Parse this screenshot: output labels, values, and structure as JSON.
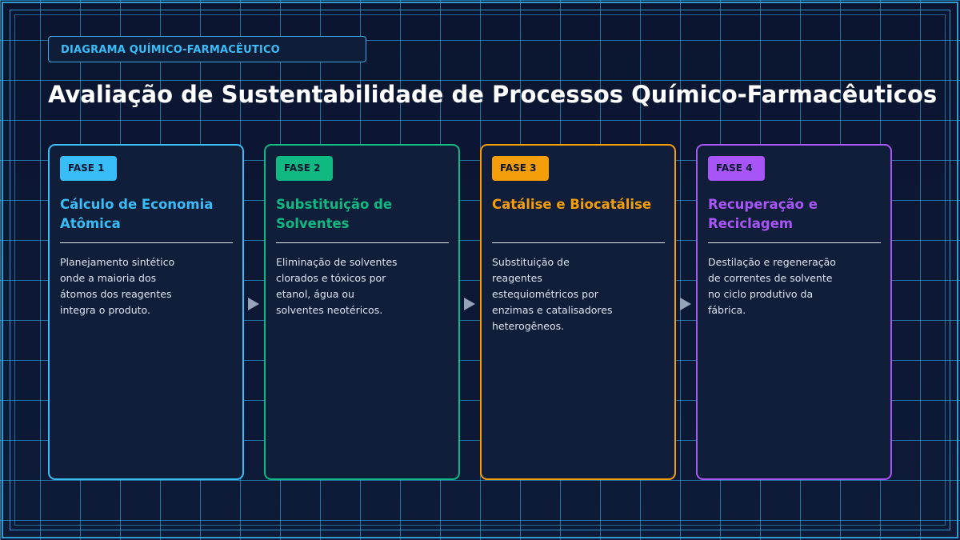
{
  "header": {
    "tag": "DIAGRAMA QUÍMICO-FARMACÊUTICO",
    "title": "Avaliação de Sustentabilidade de Processos Químico-Farmacêuticos"
  },
  "phases": [
    {
      "badge": "FASE 1",
      "title": "Cálculo de Economia Atômica",
      "text": "Planejamento sintético onde a maioria dos átomos dos reagentes integra o produto.",
      "color": "#38bdf8"
    },
    {
      "badge": "FASE 2",
      "title": "Substituição de Solventes",
      "text": "Eliminação de solventes clorados e tóxicos por etanol, água ou solventes neotéricos.",
      "color": "#10b981"
    },
    {
      "badge": "FASE 3",
      "title": "Catálise e Biocatálise",
      "text": "Substituição de reagentes estequiométricos por enzimas e catalisadores heterogêneos.",
      "color": "#f59e0b"
    },
    {
      "badge": "FASE 4",
      "title": "Recuperação e Reciclagem",
      "text": "Destilação e regeneração de correntes de solvente no ciclo produtivo da fábrica.",
      "color": "#a855f7"
    }
  ],
  "arrow_color": "#94a3b8"
}
